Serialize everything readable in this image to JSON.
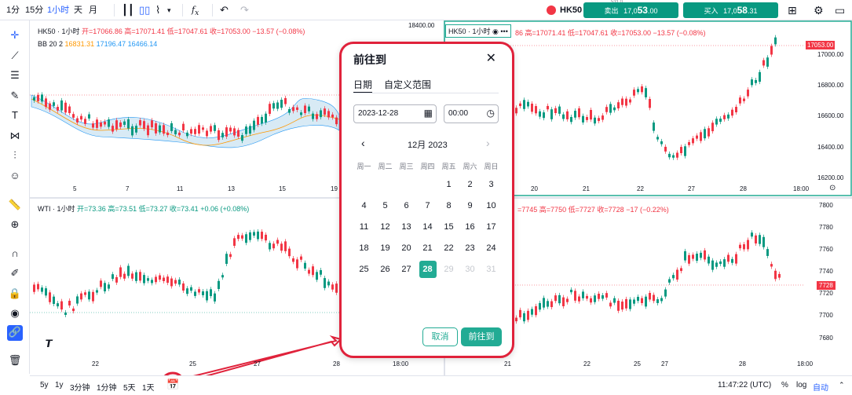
{
  "toolbar": {
    "interval_1m": "1分",
    "interval_15m": "15分",
    "interval_1h": "1小时",
    "interval_d": "天",
    "interval_m": "月"
  },
  "header": {
    "symbol": "HK50",
    "badge": "531.0",
    "sell_label": "卖出",
    "sell_price_prefix": "17,0",
    "sell_price_big": "53",
    "sell_price_suffix": ".00",
    "buy_label": "买入",
    "buy_price_prefix": "17,0",
    "buy_price_big": "58",
    "buy_price_suffix": ".31"
  },
  "pane1": {
    "title": "HK50 · 1小时",
    "o": "开=17066.86",
    "h": "高=17071.41",
    "l": "低=17047.61",
    "c": "收=17053.00",
    "chg": "−13.57 (−0.08%)",
    "bb": "BB 20 2",
    "bb1": "16831.31",
    "bb2": "17196.47",
    "bb3": "16466.14",
    "xticks": [
      "5",
      "7",
      "11",
      "13",
      "15",
      "19"
    ]
  },
  "pane2": {
    "title": "HK50 · 1小时",
    "o_partial": "86",
    "h": "高=17071.41",
    "l": "低=17047.61",
    "c": "收=17053.00",
    "chg": "−13.57 (−0.08%)",
    "price_tag": "17053.00",
    "yticks": [
      "18400.00",
      "17000.00",
      "16800.00",
      "16600.00",
      "16400.00",
      "16200.00"
    ],
    "xticks": [
      "20",
      "21",
      "22",
      "27",
      "28",
      "18:00"
    ]
  },
  "pane3": {
    "title": "WTI · 1小时",
    "o": "开=73.36",
    "h": "高=73.51",
    "l": "低=73.27",
    "c": "收=73.41",
    "chg": "+0.06 (+0.08%)",
    "xticks": [
      "22",
      "25",
      "27",
      "28",
      "18:00"
    ]
  },
  "pane4": {
    "h": "=7745",
    "hl": "高=7750",
    "l": "低=7727",
    "c": "收=7728",
    "chg": "−17 (−0.22%)",
    "price_tag": "7728",
    "yticks": [
      "7800",
      "7780",
      "7760",
      "7740",
      "7720",
      "7700",
      "7680"
    ],
    "xticks": [
      "21",
      "22",
      "25",
      "27",
      "28",
      "18:00"
    ]
  },
  "dialog": {
    "title": "前往到",
    "tab_date": "日期",
    "tab_range": "自定义范围",
    "date_value": "2023-12-28",
    "time_value": "00:00",
    "month_label": "12月 2023",
    "weekdays": [
      "周一",
      "周二",
      "周三",
      "周四",
      "周五",
      "周六",
      "周日"
    ],
    "cancel": "取消",
    "go": "前往到",
    "weeks": [
      [
        "",
        "",
        "",
        "",
        "1",
        "2",
        "3"
      ],
      [
        "4",
        "5",
        "6",
        "7",
        "8",
        "9",
        "10"
      ],
      [
        "11",
        "12",
        "13",
        "14",
        "15",
        "16",
        "17"
      ],
      [
        "18",
        "19",
        "20",
        "21",
        "22",
        "23",
        "24"
      ],
      [
        "25",
        "26",
        "27",
        "28",
        "29",
        "30",
        "31"
      ]
    ]
  },
  "bottom": {
    "r5y": "5y",
    "r1y": "1y",
    "r3m": "3分钟",
    "r1m": "1分钟",
    "r5d": "5天",
    "r1d": "1天",
    "time": "11:47:22 (UTC)",
    "pct": "%",
    "log": "log",
    "auto": "自动"
  },
  "colors": {
    "up": "#089981",
    "down": "#f23645",
    "accent": "#2962ff",
    "teal": "#22ab94",
    "highlight": "#e0223b"
  }
}
